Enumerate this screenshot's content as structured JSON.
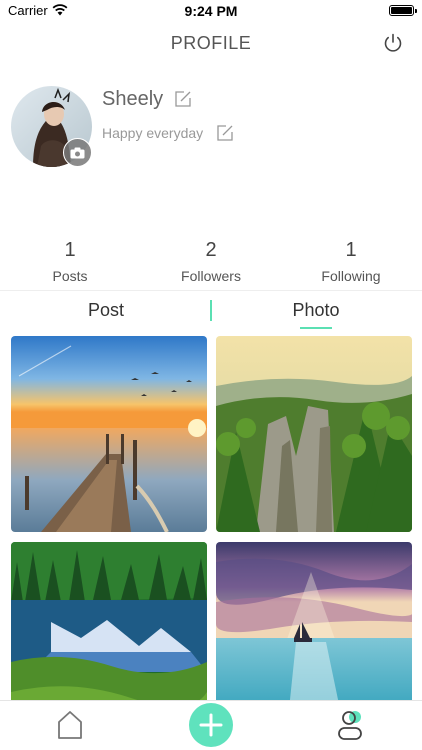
{
  "status_bar": {
    "carrier": "Carrier",
    "time": "9:24 PM"
  },
  "nav": {
    "title": "PROFILE",
    "power_icon": "power-icon"
  },
  "profile": {
    "name": "Sheely",
    "motto": "Happy everyday"
  },
  "stats": [
    {
      "value": "1",
      "label": "Posts"
    },
    {
      "value": "2",
      "label": "Followers"
    },
    {
      "value": "1",
      "label": "Following"
    }
  ],
  "tabs": {
    "post": "Post",
    "photo": "Photo",
    "active": "Photo"
  },
  "photos": [
    "pier-sunset",
    "forest-cliffs",
    "mountain-lake",
    "ocean-sunset"
  ],
  "tabbar": {
    "home_icon": "home-icon",
    "add_icon": "add-icon",
    "profile_icon": "profile-icon"
  },
  "colors": {
    "accent": "#5be0b3"
  }
}
